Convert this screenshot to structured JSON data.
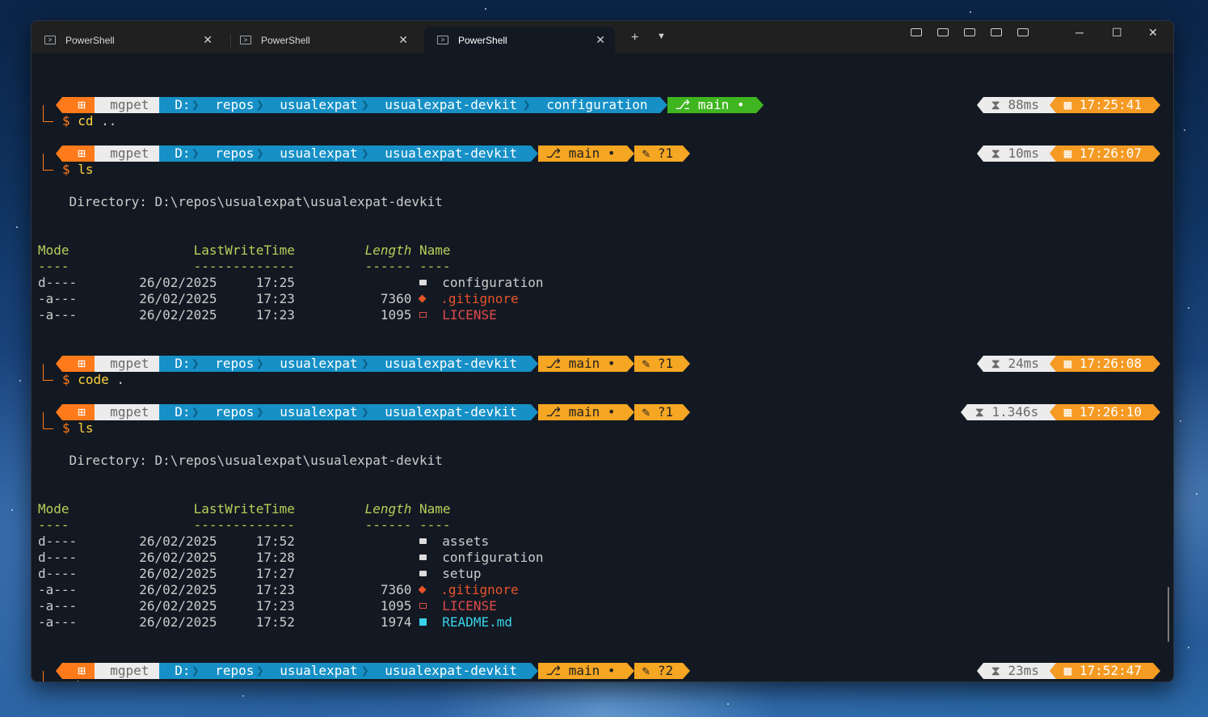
{
  "tabs": [
    {
      "title": "PowerShell",
      "active": false
    },
    {
      "title": "PowerShell",
      "active": false
    },
    {
      "title": "PowerShell",
      "active": true
    }
  ],
  "titlebar": {
    "new_tab": "+",
    "dropdown": "⌄",
    "minimize": "─",
    "maximize": "☐",
    "close": "✕"
  },
  "prompt": {
    "user": "mgpet",
    "drive": "D:",
    "segments_sub": [
      "repos",
      "usualexpat",
      "usualexpat-devkit"
    ],
    "branch": "main",
    "symbol": "$"
  },
  "prompts": [
    {
      "path_extra": "configuration",
      "git_state": "clean",
      "status": "",
      "exec": "88ms",
      "time": "17:25:41",
      "command": "cd",
      "args": ".."
    },
    {
      "path_extra": "",
      "git_state": "dirty",
      "status": "?1",
      "exec": "10ms",
      "time": "17:26:07",
      "command": "ls",
      "args": ""
    },
    {
      "path_extra": "",
      "git_state": "dirty",
      "status": "?1",
      "exec": "24ms",
      "time": "17:26:08",
      "command": "code",
      "args": "."
    },
    {
      "path_extra": "",
      "git_state": "dirty",
      "status": "?1",
      "exec": "1.346s",
      "time": "17:26:10",
      "command": "ls",
      "args": ""
    },
    {
      "path_extra": "",
      "git_state": "dirty",
      "status": "?2",
      "exec": "23ms",
      "time": "17:52:47",
      "command": "",
      "args": ""
    }
  ],
  "listing1": {
    "directory": "    Directory: D:\\repos\\usualexpat\\usualexpat-devkit",
    "headers": {
      "mode": "Mode",
      "time": "LastWriteTime",
      "length": "Length",
      "name": "Name"
    },
    "underline": {
      "mode": "----",
      "time": "-------------",
      "length": "------",
      "name": "----"
    },
    "rows": [
      {
        "mode": "d----",
        "date": "26/02/2025",
        "time": "17:25",
        "length": "",
        "icon": "folder",
        "name": "configuration"
      },
      {
        "mode": "-a---",
        "date": "26/02/2025",
        "time": "17:23",
        "length": "7360",
        "icon": "git",
        "name": ".gitignore"
      },
      {
        "mode": "-a---",
        "date": "26/02/2025",
        "time": "17:23",
        "length": "1095",
        "icon": "license",
        "name": "LICENSE"
      }
    ]
  },
  "listing2": {
    "directory": "    Directory: D:\\repos\\usualexpat\\usualexpat-devkit",
    "headers": {
      "mode": "Mode",
      "time": "LastWriteTime",
      "length": "Length",
      "name": "Name"
    },
    "underline": {
      "mode": "----",
      "time": "-------------",
      "length": "------",
      "name": "----"
    },
    "rows": [
      {
        "mode": "d----",
        "date": "26/02/2025",
        "time": "17:52",
        "length": "",
        "icon": "folder",
        "name": "assets"
      },
      {
        "mode": "d----",
        "date": "26/02/2025",
        "time": "17:28",
        "length": "",
        "icon": "folder",
        "name": "configuration"
      },
      {
        "mode": "d----",
        "date": "26/02/2025",
        "time": "17:27",
        "length": "",
        "icon": "folder",
        "name": "setup"
      },
      {
        "mode": "-a---",
        "date": "26/02/2025",
        "time": "17:23",
        "length": "7360",
        "icon": "git",
        "name": ".gitignore"
      },
      {
        "mode": "-a---",
        "date": "26/02/2025",
        "time": "17:23",
        "length": "1095",
        "icon": "license",
        "name": "LICENSE"
      },
      {
        "mode": "-a---",
        "date": "26/02/2025",
        "time": "17:52",
        "length": "1974",
        "icon": "markdown",
        "name": "README.md"
      }
    ]
  },
  "colors": {
    "os": "#ff7a1a",
    "path": "#1690c6",
    "git_clean": "#3fb51f",
    "git_dirty": "#f5a623",
    "time": "#f59a23"
  }
}
